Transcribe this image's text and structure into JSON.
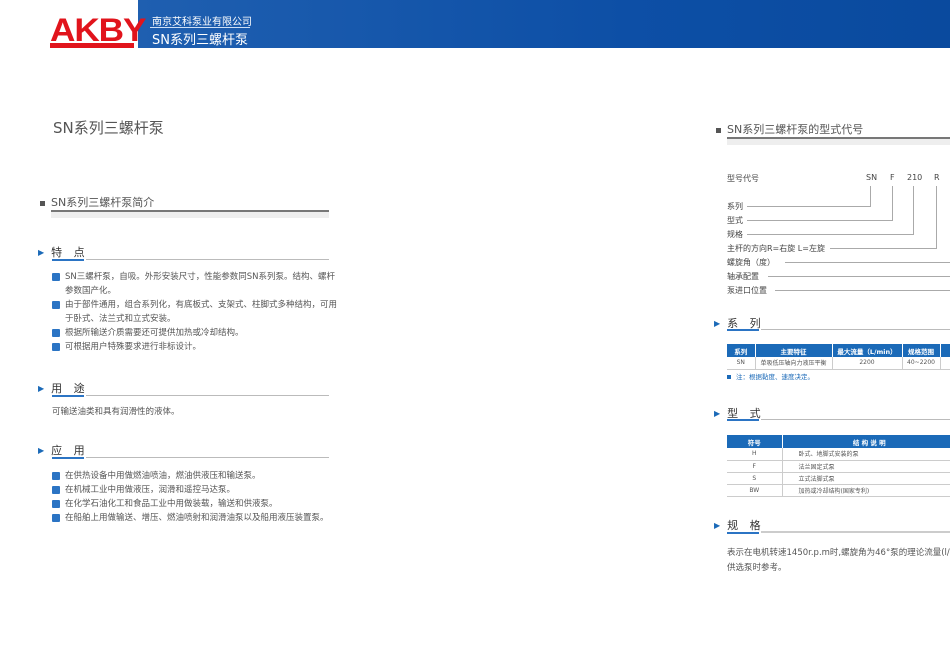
{
  "header": {
    "logo": "AKBY",
    "company": "南京艾科泵业有限公司",
    "subtitle": "SN系列三螺杆泵"
  },
  "page_title": "SN系列三螺杆泵",
  "intro": {
    "title": "SN系列三螺杆泵简介"
  },
  "features": {
    "title": "特 点",
    "items": [
      "SN三螺杆泵，自吸。外形安装尺寸，性能参数同SN系列泵。结构、螺杆参数国产化。",
      "由于部件通用，组合系列化，有底板式、支架式、柱脚式多种结构，可用于卧式、法兰式和立式安装。",
      "根据所输送介质需要还可提供加热或冷却结构。",
      "可根据用户特殊要求进行非标设计。"
    ]
  },
  "usage": {
    "title": "用 途",
    "text": "可输送油类和具有润滑性的液体。"
  },
  "application": {
    "title": "应 用",
    "items": [
      "在供热设备中用做燃油喷油，燃油供液压和输送泵。",
      "在机械工业中用做液压，润滑和遥控马达泵。",
      "在化学石油化工和食品工业中用做装载，输送和供液泵。",
      "在船舶上用做输送、增压、燃油喷射和润滑油泵以及船用液压装置泵。"
    ]
  },
  "model_code": {
    "title": "SN系列三螺杆泵的型式代号",
    "label": "型号代号",
    "codes": [
      "SN",
      "F",
      "210",
      "R"
    ],
    "parts": [
      "系列",
      "型式",
      "规格",
      "主杆的方向R=右旋 L=左旋",
      "螺旋角（度）",
      "轴承配置",
      "泵进口位置"
    ]
  },
  "series": {
    "title": "系 列",
    "headers": [
      "系列",
      "主要特征",
      "最大流量（L/min）",
      "规格范围"
    ],
    "rows": [
      [
        "SN",
        "单吸低压轴向力液压平衡",
        "2200",
        "40~2200"
      ]
    ],
    "note": "注：根据黏度、速度决定。"
  },
  "type": {
    "title": "型 式",
    "headers": [
      "符号",
      "结 构 说 明"
    ],
    "rows": [
      [
        "H",
        "卧式、地脚式安装的泵"
      ],
      [
        "F",
        "法兰固定式泵"
      ],
      [
        "S",
        "立式法脚式泵"
      ],
      [
        "BW",
        "加热或冷却结构(国家专利)"
      ]
    ]
  },
  "spec": {
    "title": "规 格",
    "lines": [
      "表示在电机转速1450r.p.m时,螺旋角为46°泵的理论流量(l/",
      "供选泵时参考。"
    ]
  },
  "colors": {
    "brand_red": "#e1141c",
    "brand_blue": "#1b6ab8"
  }
}
